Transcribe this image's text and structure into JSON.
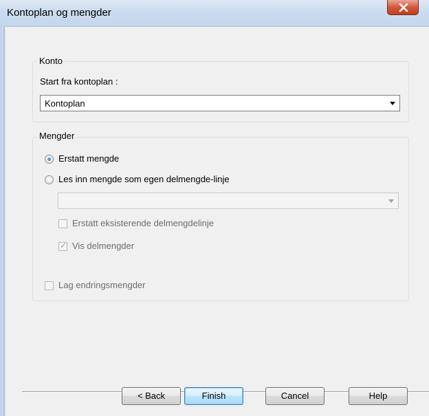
{
  "window": {
    "title": "Kontoplan og mengder"
  },
  "konto": {
    "group_label": "Konto",
    "start_label": "Start fra kontoplan :",
    "combo_value": "Kontoplan"
  },
  "mengder": {
    "group_label": "Mengder",
    "radio_replace": "Erstatt mengde",
    "radio_read": "Les inn mengde som egen delmengde-linje",
    "sub_combo_value": "",
    "check_replace_existing": "Erstatt eksisterende delmengdelinje",
    "check_show": "Vis delmengder",
    "check_change": "Lag endringsmengder"
  },
  "buttons": {
    "back": "< Back",
    "finish": "Finish",
    "cancel": "Cancel",
    "help": "Help"
  },
  "icons": {
    "close": "close-icon",
    "combo_arrow": "chevron-down-icon",
    "checkmark": "checkmark-icon"
  },
  "state": {
    "selected_radio": "Erstatt mengde",
    "vis_delmengder_checked": true,
    "erstatt_eksisterende_checked": false,
    "lag_endringsmengder_checked": false
  }
}
